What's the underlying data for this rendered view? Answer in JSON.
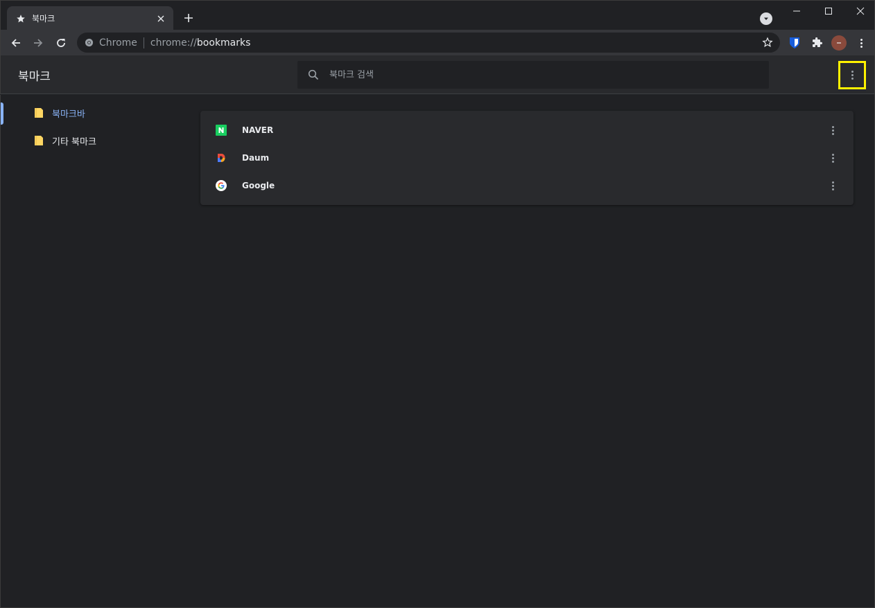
{
  "tab": {
    "title": "북마크",
    "icon": "star-icon"
  },
  "toolbar": {
    "origin_chip": "Chrome",
    "url_scheme": "chrome://",
    "url_host": "bookmarks"
  },
  "page": {
    "title": "북마크",
    "search_placeholder": "북마크 검색"
  },
  "sidebar": {
    "folders": [
      {
        "label": "북마크바",
        "selected": true
      },
      {
        "label": "기타 북마크",
        "selected": false
      }
    ]
  },
  "bookmarks": [
    {
      "name": "NAVER",
      "favicon": "naver-icon"
    },
    {
      "name": "Daum",
      "favicon": "daum-icon"
    },
    {
      "name": "Google",
      "favicon": "google-icon"
    }
  ],
  "colors": {
    "accent": "#8ab4f8",
    "highlight": "#fff200",
    "background": "#202124"
  }
}
